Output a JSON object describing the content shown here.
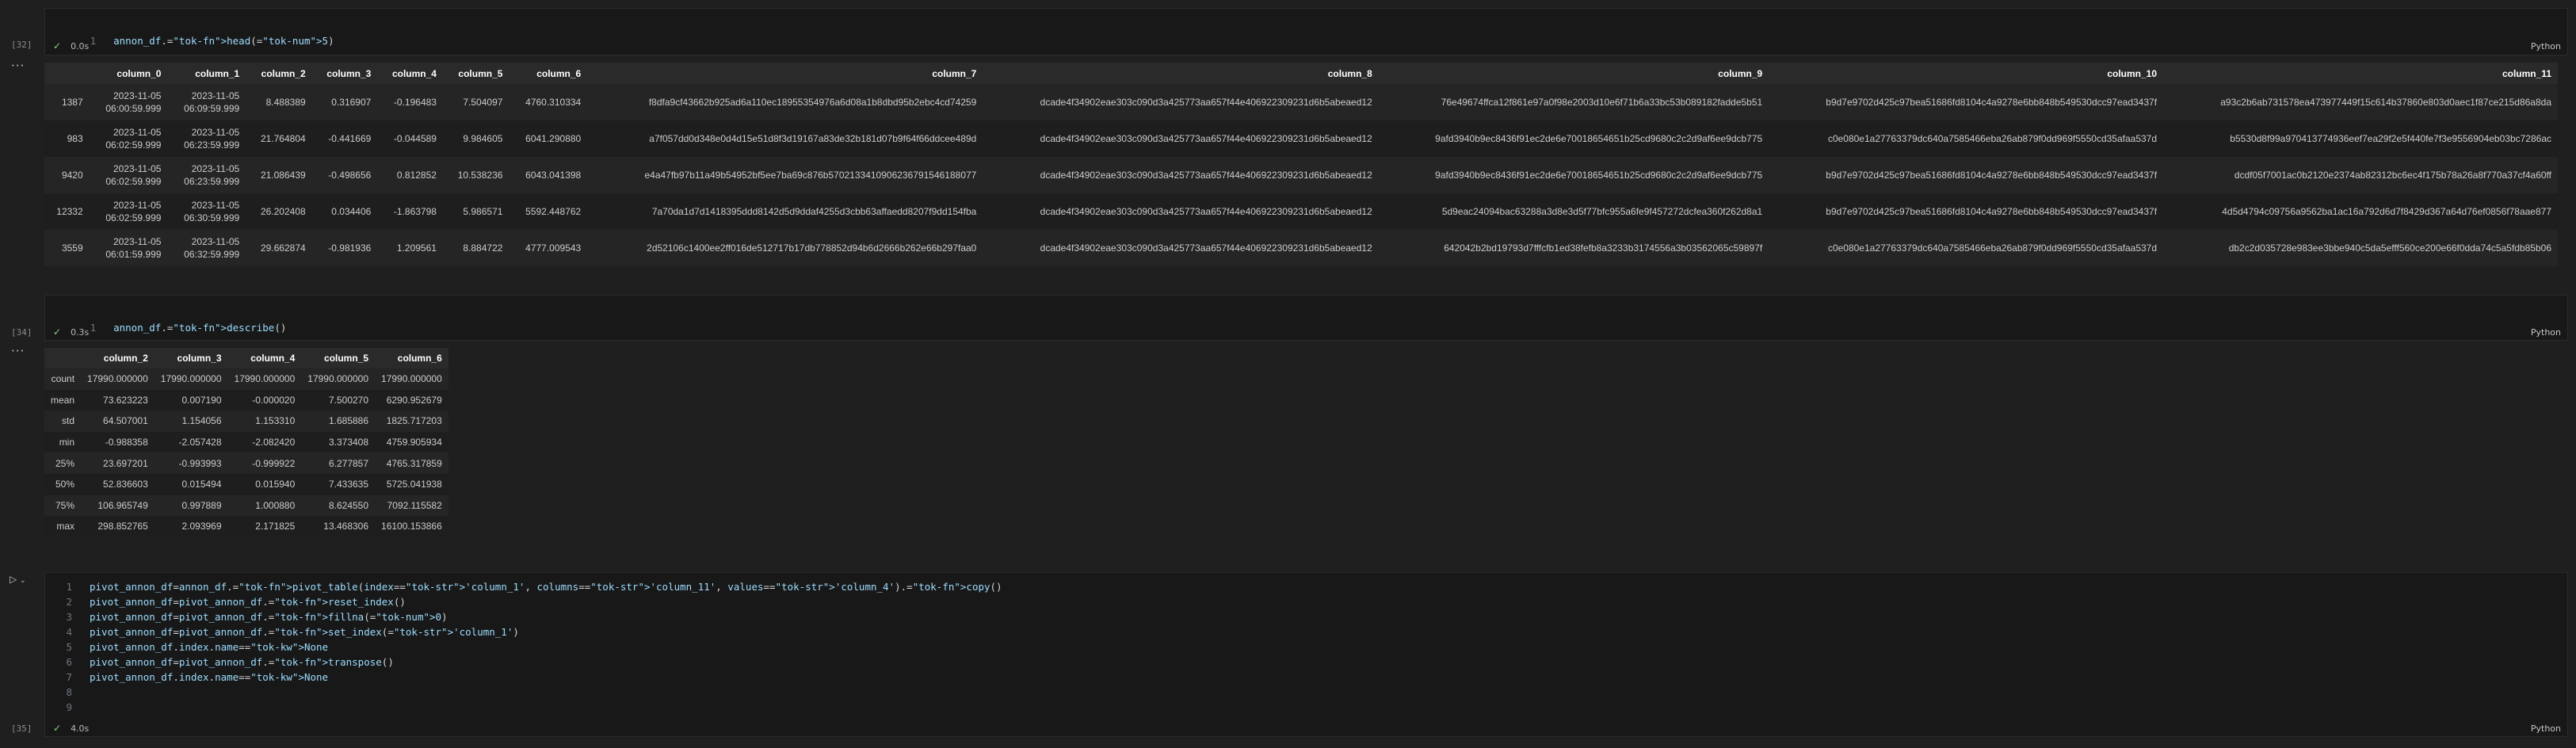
{
  "cells": [
    {
      "exec_count": "[32]",
      "code_lines": [
        {
          "num": "1",
          "text": "annon_df.head(5)"
        }
      ],
      "duration": "0.0s",
      "language": "Python"
    },
    {
      "exec_count": "[34]",
      "code_lines": [
        {
          "num": "1",
          "text": "annon_df.describe()"
        }
      ],
      "duration": "0.3s",
      "language": "Python"
    },
    {
      "exec_count": "[35]",
      "code_lines": [
        {
          "num": "1",
          "text": "pivot_annon_df=annon_df.pivot_table(index='column_1', columns='column_11', values='column_4').copy()"
        },
        {
          "num": "2",
          "text": "pivot_annon_df=pivot_annon_df.reset_index()"
        },
        {
          "num": "3",
          "text": "pivot_annon_df=pivot_annon_df.fillna(0)"
        },
        {
          "num": "4",
          "text": "pivot_annon_df=pivot_annon_df.set_index('column_1')"
        },
        {
          "num": "5",
          "text": "pivot_annon_df.index.name=None"
        },
        {
          "num": "6",
          "text": "pivot_annon_df=pivot_annon_df.transpose()"
        },
        {
          "num": "7",
          "text": "pivot_annon_df.index.name=None"
        },
        {
          "num": "8",
          "text": ""
        },
        {
          "num": "9",
          "text": ""
        }
      ],
      "duration": "4.0s",
      "language": "Python"
    }
  ],
  "head_table": {
    "columns": [
      "",
      "column_0",
      "column_1",
      "column_2",
      "column_3",
      "column_4",
      "column_5",
      "column_6",
      "column_7",
      "column_8",
      "column_9",
      "column_10",
      "column_11"
    ],
    "rows": [
      [
        "1387",
        "2023-11-05\n06:00:59.999",
        "2023-11-05\n06:09:59.999",
        "8.488389",
        "0.316907",
        "-0.196483",
        "7.504097",
        "4760.310334",
        "f8dfa9cf43662b925ad6a110ec18955354976a6d08a1b8dbd95b2ebc4cd74259",
        "dcade4f34902eae303c090d3a425773aa657f44e406922309231d6b5abeaed12",
        "76e49674ffca12f861e97a0f98e2003d10e6f71b6a33bc53b089182fadde5b51",
        "b9d7e9702d425c97bea51686fd8104c4a9278e6bb848b549530dcc97ead3437f",
        "a93c2b6ab731578ea473977449f15c614b37860e803d0aec1f87ce215d86a8da"
      ],
      [
        "983",
        "2023-11-05\n06:02:59.999",
        "2023-11-05\n06:23:59.999",
        "21.764804",
        "-0.441669",
        "-0.044589",
        "9.984605",
        "6041.290880",
        "a7f057dd0d348e0d4d15e51d8f3d19167a83de32b181d07b9f64f66ddcee489d",
        "dcade4f34902eae303c090d3a425773aa657f44e406922309231d6b5abeaed12",
        "9afd3940b9ec8436f91ec2de6e70018654651b25cd9680c2c2d9af6ee9dcb775",
        "c0e080e1a27763379dc640a7585466eba26ab879f0dd969f5550cd35afaa537d",
        "b5530d8f99a970413774936eef7ea29f2e5f440fe7f3e9556904eb03bc7286ac"
      ],
      [
        "9420",
        "2023-11-05\n06:02:59.999",
        "2023-11-05\n06:23:59.999",
        "21.086439",
        "-0.498656",
        "0.812852",
        "10.538236",
        "6043.041398",
        "e4a47fb97b11a49b54952bf5ee7ba69c876b5702133410906236791546188077",
        "dcade4f34902eae303c090d3a425773aa657f44e406922309231d6b5abeaed12",
        "9afd3940b9ec8436f91ec2de6e70018654651b25cd9680c2c2d9af6ee9dcb775",
        "b9d7e9702d425c97bea51686fd8104c4a9278e6bb848b549530dcc97ead3437f",
        "dcdf05f7001ac0b2120e2374ab82312bc6ec4f175b78a26a8f770a37cf4a60ff"
      ],
      [
        "12332",
        "2023-11-05\n06:02:59.999",
        "2023-11-05\n06:30:59.999",
        "26.202408",
        "0.034406",
        "-1.863798",
        "5.986571",
        "5592.448762",
        "7a70da1d7d1418395ddd8142d5d9ddaf4255d3cbb63affaedd8207f9dd154fba",
        "dcade4f34902eae303c090d3a425773aa657f44e406922309231d6b5abeaed12",
        "5d9eac24094bac63288a3d8e3d5f77bfc955a6fe9f457272dcfea360f262d8a1",
        "b9d7e9702d425c97bea51686fd8104c4a9278e6bb848b549530dcc97ead3437f",
        "4d5d4794c09756a9562ba1ac16a792d6d7f8429d367a64d76ef0856f78aae877"
      ],
      [
        "3559",
        "2023-11-05\n06:01:59.999",
        "2023-11-05\n06:32:59.999",
        "29.662874",
        "-0.981936",
        "1.209561",
        "8.884722",
        "4777.009543",
        "2d52106c1400ee2ff016de512717b17db778852d94b6d2666b262e66b297faa0",
        "dcade4f34902eae303c090d3a425773aa657f44e406922309231d6b5abeaed12",
        "642042b2bd19793d7fffcfb1ed38fefb8a3233b3174556a3b03562065c59897f",
        "c0e080e1a27763379dc640a7585466eba26ab879f0dd969f5550cd35afaa537d",
        "db2c2d035728e983ee3bbe940c5da5efff560ce200e66f0dda74c5a5fdb85b06"
      ]
    ]
  },
  "describe_table": {
    "columns": [
      "",
      "column_2",
      "column_3",
      "column_4",
      "column_5",
      "column_6"
    ],
    "rows": [
      [
        "count",
        "17990.000000",
        "17990.000000",
        "17990.000000",
        "17990.000000",
        "17990.000000"
      ],
      [
        "mean",
        "73.623223",
        "0.007190",
        "-0.000020",
        "7.500270",
        "6290.952679"
      ],
      [
        "std",
        "64.507001",
        "1.154056",
        "1.153310",
        "1.685886",
        "1825.717203"
      ],
      [
        "min",
        "-0.988358",
        "-2.057428",
        "-2.082420",
        "3.373408",
        "4759.905934"
      ],
      [
        "25%",
        "23.697201",
        "-0.993993",
        "-0.999922",
        "6.277857",
        "4765.317859"
      ],
      [
        "50%",
        "52.836603",
        "0.015494",
        "0.015940",
        "7.433635",
        "5725.041938"
      ],
      [
        "75%",
        "106.965749",
        "0.997889",
        "1.000880",
        "8.624550",
        "7092.115582"
      ],
      [
        "max",
        "298.852765",
        "2.093969",
        "2.171825",
        "13.468306",
        "16100.153866"
      ]
    ]
  },
  "icons": {
    "more": "more-horizontal-icon",
    "check": "check-icon",
    "run": "run-icon",
    "chevron": "chevron-down-icon"
  },
  "colors": {
    "background": "#1f1f1f",
    "cell": "#181818",
    "success": "#89d185"
  }
}
